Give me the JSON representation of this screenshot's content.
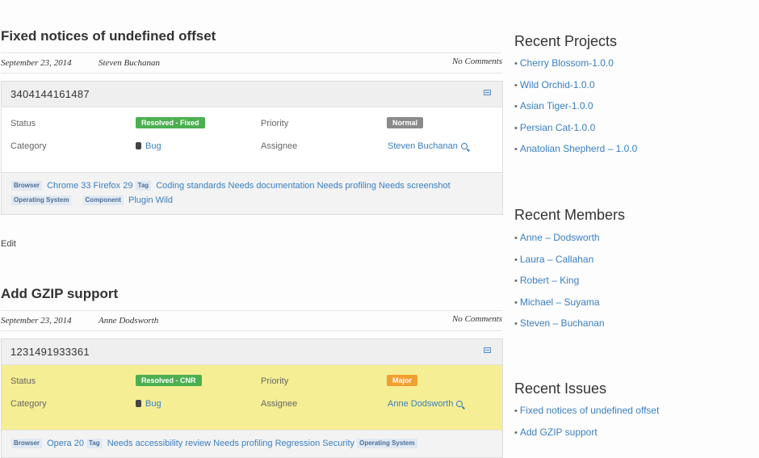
{
  "posts": [
    {
      "title": "Fixed notices of undefined offset",
      "date": "September 23, 2014",
      "author": "Steven Buchanan",
      "comments": "No Comments",
      "issue_id": "3404144161487",
      "fields": {
        "status_label": "Status",
        "status_value": "Resolved - Fixed",
        "status_color": "#4caf50",
        "priority_label": "Priority",
        "priority_value": "Normal",
        "priority_color": "#8a8a8a",
        "category_label": "Category",
        "category_value": "Bug",
        "assignee_label": "Assignee",
        "assignee_value": "Steven Buchanan"
      },
      "tags": {
        "browser_label": "Browser",
        "browser_values": "Chrome 33 Firefox 29",
        "tag_label": "Tag",
        "tag_values": "Coding standards Needs documentation Needs profiling Needs screenshot",
        "os_label": "Operating System",
        "component_label": "Component",
        "component_values": "Plugin Wild"
      },
      "edit": "Edit"
    },
    {
      "title": "Add GZIP support",
      "date": "September 23, 2014",
      "author": "Anne Dodsworth",
      "comments": "No Comments",
      "issue_id": "1231491933361",
      "fields": {
        "status_label": "Status",
        "status_value": "Resolved - CNR",
        "status_color": "#4caf50",
        "priority_label": "Priority",
        "priority_value": "Major",
        "priority_color": "#f0a030",
        "category_label": "Category",
        "category_value": "Bug",
        "assignee_label": "Assignee",
        "assignee_value": "Anne Dodsworth"
      },
      "tags": {
        "browser_label": "Browser",
        "browser_values": "Opera 20",
        "tag_label": "Tag",
        "tag_values": "Needs accessibility review Needs profiling Regression Security",
        "os_label": "Operating System"
      }
    }
  ],
  "sidebar": {
    "recent_projects": {
      "title": "Recent Projects",
      "items": [
        "Cherry Blossom-1.0.0",
        "Wild Orchid-1.0.0",
        "Asian Tiger-1.0.0",
        "Persian Cat-1.0.0",
        "Anatolian Shepherd – 1.0.0"
      ]
    },
    "recent_members": {
      "title": "Recent Members",
      "items": [
        "Anne – Dodsworth",
        "Laura – Callahan",
        "Robert – King",
        "Michael – Suyama",
        "Steven – Buchanan"
      ]
    },
    "recent_issues": {
      "title": "Recent Issues",
      "items": [
        "Fixed notices of undefined offset",
        "Add GZIP support"
      ]
    }
  }
}
